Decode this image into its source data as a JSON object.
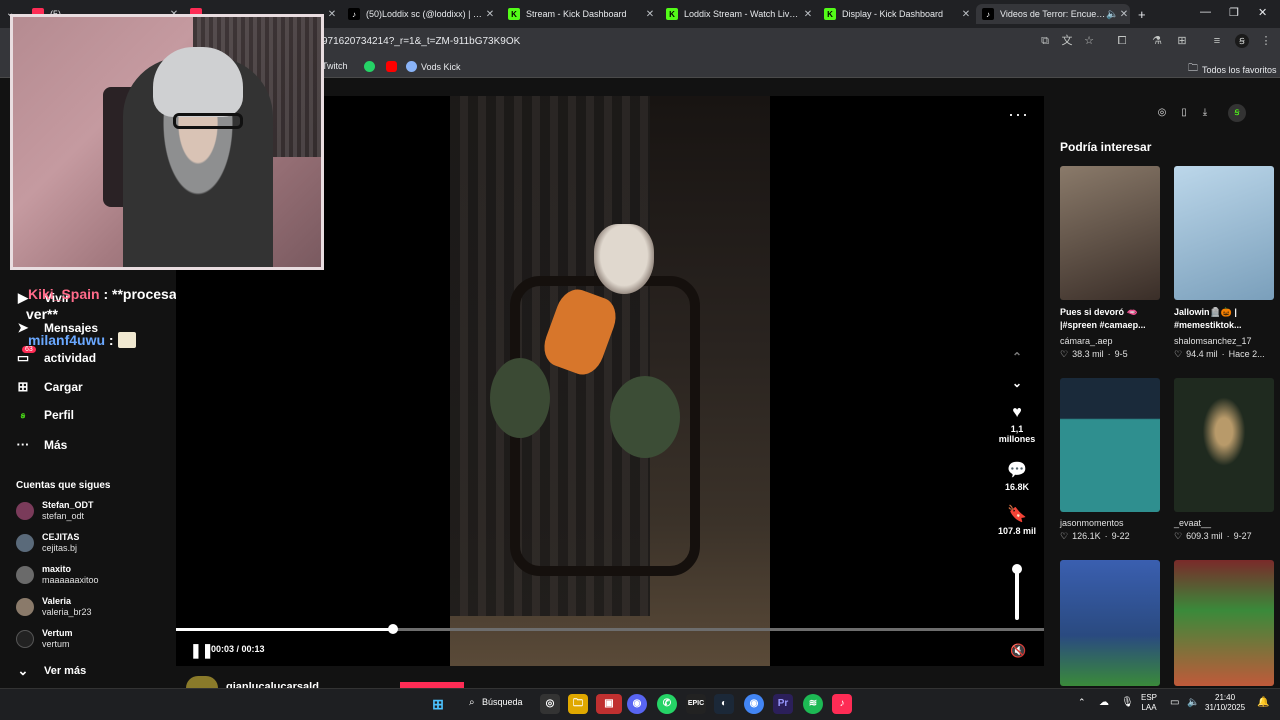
{
  "browser": {
    "tabs": [
      {
        "label": "(5) ",
        "icon": "tiktok"
      },
      {
        "label": "",
        "icon": "tiktok"
      },
      {
        "label": "(50)Loddix sc (@loddixx) | TikTok",
        "icon": "tiktok"
      },
      {
        "label": "Stream - Kick Dashboard",
        "icon": "kick"
      },
      {
        "label": "Loddix Stream - Watch Live on Kick",
        "icon": "kick"
      },
      {
        "label": "Display - Kick Dashboard",
        "icon": "kick"
      },
      {
        "label": "Videos de Terror: Encuentra",
        "icon": "tiktok"
      }
    ],
    "url": "971620734214?_r=1&_t=ZM-911bG73K9OK",
    "bookmarks": [
      "Twitch",
      "Vods Kick"
    ],
    "all_bookmarks": "Todos los favoritos"
  },
  "chat": [
    {
      "user": "Kiki_Spain",
      "message": ": **procesando lo que acabo de",
      "message2": "ver**",
      "color": "#ff6b8a"
    },
    {
      "user": "milanf4uwu",
      "message": ":",
      "color": "#6aa8ff"
    }
  ],
  "sidebar": {
    "nav": [
      {
        "label": "Vivir",
        "icon": "live-icon"
      },
      {
        "label": "Mensajes",
        "icon": "send-icon"
      },
      {
        "label": "actividad",
        "icon": "inbox-icon",
        "badge": "63"
      },
      {
        "label": "Cargar",
        "icon": "plus-icon"
      },
      {
        "label": "Perfil",
        "icon": "profile-icon"
      },
      {
        "label": "Más",
        "icon": "more-icon"
      }
    ],
    "following_title": "Cuentas que sigues",
    "accounts": [
      {
        "name": "Stefan_ODT",
        "handle": "stefan_odt"
      },
      {
        "name": "CEJITAS",
        "handle": "cejitas.bj"
      },
      {
        "name": "maxito",
        "handle": "maaaaaaxitoo"
      },
      {
        "name": "Valeria",
        "handle": "valeria_br23"
      },
      {
        "name": "Vertum",
        "handle": "vertum"
      }
    ],
    "see_more": "Ver más"
  },
  "player": {
    "likes": "1,1 millones",
    "comments": "16.8K",
    "saves": "107.8 mil",
    "time": "00:03 / 00:13",
    "progress": 0.25,
    "volume": 1.0,
    "below_username": "gianlucalucarsald"
  },
  "right_panel": {
    "title": "Podría interesar",
    "videos": [
      {
        "caption": "Pues si devoró 🫦 |#spreen #camaep...",
        "user": "cámara_.aep",
        "views": "38.3 mil",
        "date": "9-5",
        "color": "#6a5a4a"
      },
      {
        "caption": "Jallowin🪦🎃 | #memestiktok...",
        "user": "shalomsanchez_17",
        "views": "94.4 mil",
        "date": "Hace 2...",
        "color": "#a6cbe3"
      },
      {
        "caption": "",
        "user": "jasonmomentos",
        "views": "126.1K",
        "date": "9-22",
        "color": "#2c6f77"
      },
      {
        "caption": "",
        "user": "_evaat__",
        "views": "609.3 mil",
        "date": "9-27",
        "color": "#1f2a1f"
      },
      {
        "caption": "",
        "user": "",
        "views": "",
        "date": "",
        "color": "#3a5fb0"
      },
      {
        "caption": "",
        "user": "",
        "views": "",
        "date": "",
        "color": "#7a2a2a"
      }
    ]
  },
  "taskbar": {
    "search": "Búsqueda",
    "lang": [
      "ESP",
      "LAA"
    ],
    "time": "21:40",
    "date": "31/10/2025"
  }
}
